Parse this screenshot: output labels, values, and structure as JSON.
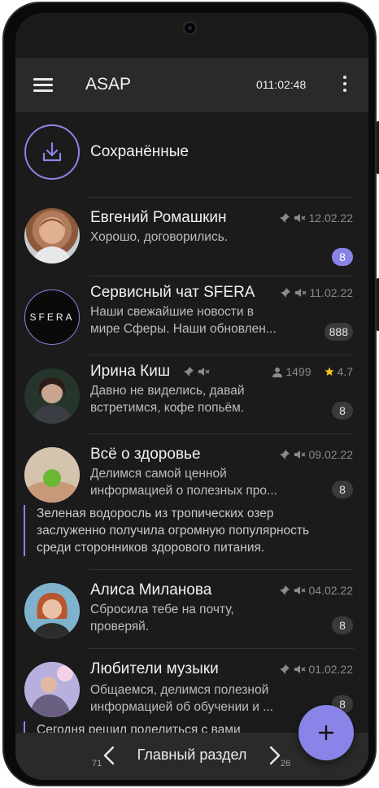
{
  "appbar": {
    "title": "ASAP",
    "timer": "011:02:48"
  },
  "saved": {
    "label": "Сохранённые"
  },
  "chats": [
    {
      "name": "Евгений Ромашкин",
      "date": "12.02.22",
      "preview": "Хорошо, договорились.",
      "badge": "8"
    },
    {
      "name": "Сервисный чат SFERA",
      "date": "11.02.22",
      "preview": "Наши свежайшие новости в\nмире Сферы. Наши обновлен...",
      "badge": "888",
      "logo_text": "SFERA"
    },
    {
      "name": "Ирина Киш",
      "members": "1499",
      "rating": "4.7",
      "preview": "Давно не виделись, давай\nвстретимся, кофе попьём.",
      "badge": "8"
    },
    {
      "name": "Всё о здоровье",
      "date": "09.02.22",
      "preview": "Делимся самой ценной\nинформацией о полезных про...",
      "badge": "8",
      "quote": "Зеленая водоросль из тропических озер\nзаслуженно получила огромную популярность\nсреди сторонников здорового питания."
    },
    {
      "name": "Алиса Миланова",
      "date": "04.02.22",
      "preview": "Сбросила тебе на почту,\nпроверяй.",
      "badge": "8"
    },
    {
      "name": "Любители музыки",
      "date": "01.02.22",
      "preview": "Общаемся, делимся полезной\nинформацией об обучении и ...",
      "badge": "8",
      "quote": "Сегодня решил поделиться с вами"
    }
  ],
  "bottom": {
    "title": "Главный раздел",
    "prev_count": "71",
    "next_count": "26"
  },
  "icons": [
    "menu-icon",
    "kebab-icon",
    "download-icon",
    "pin-icon",
    "mute-icon",
    "person-icon",
    "star-icon",
    "chevron-left-icon",
    "chevron-right-icon",
    "plus-icon"
  ],
  "colors": {
    "accent": "#8a84e8",
    "background": "#1b1b1b",
    "bar": "#2a2a2a",
    "star": "#f5c518"
  }
}
